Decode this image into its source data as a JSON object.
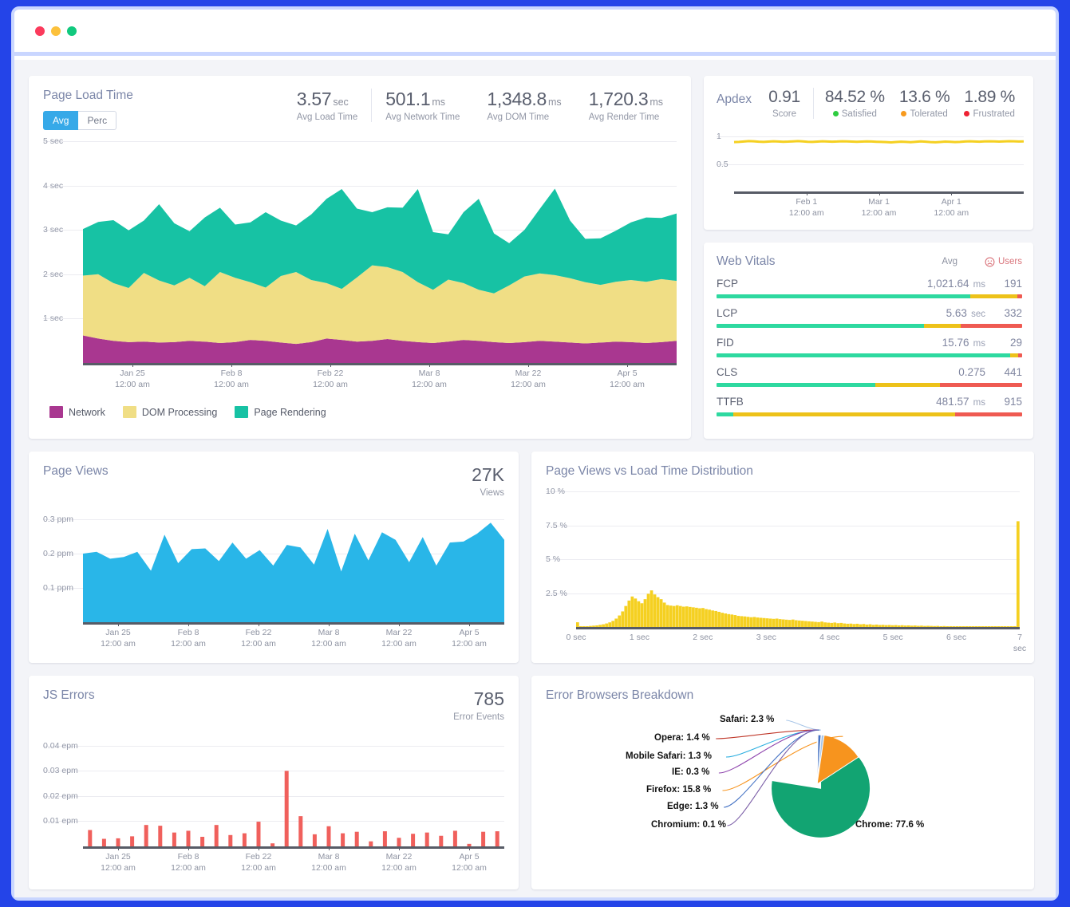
{
  "window": {
    "dots": [
      "close",
      "minimize",
      "maximize"
    ]
  },
  "page_load": {
    "title": "Page Load Time",
    "toggle": {
      "avg": "Avg",
      "perc": "Perc",
      "selected": "Avg"
    },
    "metrics": [
      {
        "value": "3.57",
        "unit": "sec",
        "label": "Avg Load Time"
      },
      {
        "value": "501.1",
        "unit": "ms",
        "label": "Avg Network Time"
      },
      {
        "value": "1,348.8",
        "unit": "ms",
        "label": "Avg DOM Time"
      },
      {
        "value": "1,720.3",
        "unit": "ms",
        "label": "Avg Render Time"
      }
    ],
    "legend": [
      {
        "label": "Network",
        "color": "#a93790"
      },
      {
        "label": "DOM Processing",
        "color": "#f0de85"
      },
      {
        "label": "Page Rendering",
        "color": "#17c2a4"
      }
    ]
  },
  "apdex": {
    "title": "Apdex",
    "score": {
      "value": "0.91",
      "label": "Score"
    },
    "buckets": [
      {
        "value": "84.52 %",
        "label": "Satisfied",
        "color": "#2ecc40"
      },
      {
        "value": "13.6 %",
        "label": "Tolerated",
        "color": "#f79a1e"
      },
      {
        "value": "1.89 %",
        "label": "Frustrated",
        "color": "#ee2233"
      }
    ]
  },
  "web_vitals": {
    "title": "Web Vitals",
    "col_avg": "Avg",
    "col_users": "Users",
    "users_icon": "frowning-face-icon",
    "rows": [
      {
        "name": "FCP",
        "value": "1,021.64",
        "unit": "ms",
        "users": "191",
        "good": 83,
        "needs": 15.5,
        "poor": 1.5
      },
      {
        "name": "LCP",
        "value": "5.63",
        "unit": "sec",
        "users": "332",
        "good": 68,
        "needs": 12,
        "poor": 20
      },
      {
        "name": "FID",
        "value": "15.76",
        "unit": "ms",
        "users": "29",
        "good": 96,
        "needs": 2.6,
        "poor": 1.4
      },
      {
        "name": "CLS",
        "value": "0.275",
        "unit": "",
        "users": "441",
        "good": 52,
        "needs": 21,
        "poor": 27
      },
      {
        "name": "TTFB",
        "value": "481.57",
        "unit": "ms",
        "users": "915",
        "good": 5.5,
        "needs": 72.5,
        "poor": 22
      }
    ],
    "colors": {
      "good": "#2ed9a0",
      "needs": "#edc21a",
      "poor": "#ef5a52"
    }
  },
  "page_views": {
    "title": "Page Views",
    "total": "27K",
    "total_label": "Views"
  },
  "distribution": {
    "title": "Page Views vs Load Time Distribution"
  },
  "js_errors": {
    "title": "JS Errors",
    "total": "785",
    "total_label": "Error Events"
  },
  "browsers": {
    "title": "Error Browsers Breakdown"
  },
  "chart_data": [
    {
      "id": "page-load-time",
      "type": "area",
      "stacked": true,
      "title": "Page Load Time",
      "ylabel": "",
      "ylim": [
        0,
        5
      ],
      "yticks": [
        "1 sec",
        "2 sec",
        "3 sec",
        "4 sec",
        "5 sec"
      ],
      "ytick_values": [
        1,
        2,
        3,
        4,
        5
      ],
      "xticks": [
        "Jan 25",
        "Feb 8",
        "Feb 22",
        "Mar 8",
        "Mar 22",
        "Apr 5"
      ],
      "xtick_sub": "12:00 am",
      "grid": true,
      "legend_position": "bottom-left",
      "series": [
        {
          "name": "Network",
          "color": "#a93790",
          "values": [
            0.62,
            0.55,
            0.5,
            0.47,
            0.48,
            0.46,
            0.47,
            0.5,
            0.48,
            0.45,
            0.47,
            0.52,
            0.5,
            0.46,
            0.43,
            0.47,
            0.55,
            0.52,
            0.48,
            0.5,
            0.54,
            0.5,
            0.47,
            0.45,
            0.48,
            0.52,
            0.5,
            0.47,
            0.45,
            0.47,
            0.5,
            0.48,
            0.46,
            0.44,
            0.46,
            0.48,
            0.47,
            0.45,
            0.47,
            0.5
          ]
        },
        {
          "name": "DOM Processing",
          "color": "#f0de85",
          "values": [
            1.35,
            1.45,
            1.3,
            1.22,
            1.55,
            1.4,
            1.28,
            1.42,
            1.25,
            1.6,
            1.45,
            1.3,
            1.2,
            1.5,
            1.62,
            1.4,
            1.25,
            1.15,
            1.45,
            1.7,
            1.62,
            1.55,
            1.35,
            1.2,
            1.4,
            1.28,
            1.15,
            1.1,
            1.3,
            1.48,
            1.52,
            1.5,
            1.45,
            1.38,
            1.3,
            1.35,
            1.4,
            1.38,
            1.42,
            1.35
          ]
        },
        {
          "name": "Page Rendering",
          "color": "#17c2a4",
          "values": [
            1.05,
            1.18,
            1.42,
            1.3,
            1.18,
            1.72,
            1.4,
            1.05,
            1.55,
            1.45,
            1.2,
            1.35,
            1.7,
            1.25,
            1.05,
            1.48,
            1.9,
            2.25,
            1.55,
            1.2,
            1.35,
            1.45,
            2.1,
            1.3,
            1.02,
            1.6,
            2.05,
            1.35,
            0.95,
            1.05,
            1.45,
            1.95,
            1.3,
            0.98,
            1.05,
            1.15,
            1.3,
            1.45,
            1.38,
            1.52
          ]
        }
      ]
    },
    {
      "id": "apdex-trend",
      "type": "line",
      "title": "Apdex",
      "color": "#f5d021",
      "ylim": [
        0,
        1.15
      ],
      "yticks": [
        "0.5",
        "1"
      ],
      "ytick_values": [
        0.5,
        1
      ],
      "xticks": [
        "Feb 1",
        "Mar 1",
        "Apr 1"
      ],
      "xtick_sub": "12:00 am",
      "values": [
        0.9,
        0.905,
        0.912,
        0.918,
        0.915,
        0.908,
        0.905,
        0.91,
        0.916,
        0.912,
        0.906,
        0.909,
        0.914,
        0.918,
        0.913,
        0.907,
        0.904,
        0.909,
        0.915,
        0.912,
        0.908,
        0.911,
        0.916,
        0.913,
        0.909,
        0.906,
        0.91,
        0.914,
        0.911,
        0.907,
        0.904,
        0.9,
        0.896,
        0.902,
        0.908,
        0.905,
        0.899,
        0.906,
        0.913,
        0.908,
        0.901,
        0.897,
        0.903,
        0.91,
        0.906,
        0.9,
        0.905,
        0.912,
        0.915,
        0.911,
        0.908,
        0.913,
        0.916,
        0.914,
        0.91,
        0.913,
        0.917,
        0.915,
        0.912,
        0.914
      ]
    },
    {
      "id": "page-views",
      "type": "area",
      "title": "Page Views",
      "color": "#29b6e8",
      "ylabel": "ppm",
      "ylim": [
        0,
        0.33
      ],
      "yticks": [
        "0.1 ppm",
        "0.2 ppm",
        "0.3 ppm"
      ],
      "ytick_values": [
        0.1,
        0.2,
        0.3
      ],
      "xticks": [
        "Jan 25",
        "Feb 8",
        "Feb 22",
        "Mar 8",
        "Mar 22",
        "Apr 5"
      ],
      "xtick_sub": "12:00 am",
      "values": [
        0.2,
        0.205,
        0.185,
        0.19,
        0.205,
        0.15,
        0.255,
        0.172,
        0.213,
        0.215,
        0.178,
        0.232,
        0.185,
        0.21,
        0.165,
        0.225,
        0.218,
        0.168,
        0.272,
        0.148,
        0.258,
        0.18,
        0.262,
        0.24,
        0.175,
        0.248,
        0.165,
        0.232,
        0.235,
        0.258,
        0.29,
        0.24
      ]
    },
    {
      "id": "load-time-distribution",
      "type": "bar",
      "title": "Page Views vs Load Time Distribution",
      "color": "#f5d021",
      "ylim": [
        0,
        10
      ],
      "yticks": [
        "2.5 %",
        "5 %",
        "7.5 %",
        "10 %"
      ],
      "ytick_values": [
        2.5,
        5,
        7.5,
        10
      ],
      "xticks": [
        "0 sec",
        "1 sec",
        "2 sec",
        "3 sec",
        "4 sec",
        "5 sec",
        "6 sec",
        "7 sec"
      ],
      "xlim": [
        0,
        7
      ],
      "values": [
        0.35,
        0.05,
        0.05,
        0.05,
        0.08,
        0.1,
        0.12,
        0.16,
        0.2,
        0.26,
        0.34,
        0.45,
        0.62,
        0.85,
        1.15,
        1.55,
        1.95,
        2.25,
        2.1,
        1.9,
        1.75,
        2.05,
        2.45,
        2.7,
        2.4,
        2.2,
        2.05,
        1.8,
        1.62,
        1.58,
        1.55,
        1.6,
        1.55,
        1.5,
        1.52,
        1.48,
        1.45,
        1.42,
        1.38,
        1.4,
        1.32,
        1.28,
        1.22,
        1.18,
        1.12,
        1.05,
        1.0,
        0.95,
        0.92,
        0.88,
        0.82,
        0.8,
        0.78,
        0.75,
        0.72,
        0.74,
        0.7,
        0.68,
        0.66,
        0.64,
        0.62,
        0.6,
        0.62,
        0.58,
        0.56,
        0.54,
        0.52,
        0.55,
        0.5,
        0.48,
        0.46,
        0.44,
        0.42,
        0.4,
        0.38,
        0.36,
        0.4,
        0.34,
        0.32,
        0.3,
        0.33,
        0.28,
        0.3,
        0.26,
        0.24,
        0.25,
        0.22,
        0.24,
        0.2,
        0.22,
        0.18,
        0.2,
        0.16,
        0.18,
        0.15,
        0.16,
        0.14,
        0.15,
        0.13,
        0.14,
        0.12,
        0.13,
        0.11,
        0.12,
        0.1,
        0.11,
        0.09,
        0.1,
        0.08,
        0.09,
        0.08,
        0.07,
        0.08,
        0.06,
        0.07,
        0.05,
        0.06,
        0.05,
        0.04,
        0.05,
        0.04,
        0.03,
        0.04,
        0.03,
        0.02,
        0.03,
        0.02,
        0.02,
        0.01,
        0.02,
        0.01,
        0.01,
        0.01,
        0.01,
        0.01,
        0.01,
        0.01,
        7.8
      ]
    },
    {
      "id": "js-errors",
      "type": "bar",
      "title": "JS Errors",
      "color": "#f0605c",
      "ylabel": "epm",
      "ylim": [
        0,
        0.045
      ],
      "yticks": [
        "0.01 epm",
        "0.02 epm",
        "0.03 epm",
        "0.04 epm"
      ],
      "ytick_values": [
        0.01,
        0.02,
        0.03,
        0.04
      ],
      "xticks": [
        "Jan 25",
        "Feb 8",
        "Feb 22",
        "Mar 8",
        "Mar 22",
        "Apr 5"
      ],
      "xtick_sub": "12:00 am",
      "values": [
        0.0065,
        0.003,
        0.0032,
        0.004,
        0.0085,
        0.0082,
        0.0055,
        0.0062,
        0.0038,
        0.0085,
        0.0045,
        0.0052,
        0.0098,
        0.0012,
        0.03,
        0.012,
        0.0048,
        0.008,
        0.0052,
        0.0058,
        0.002,
        0.006,
        0.0034,
        0.005,
        0.0055,
        0.0042,
        0.0062,
        0.001,
        0.0058,
        0.006
      ]
    },
    {
      "id": "error-browsers-breakdown",
      "type": "pie",
      "title": "Error Browsers Breakdown",
      "labels": [
        "Chrome",
        "Firefox",
        "Safari",
        "Opera",
        "Mobile Safari",
        "Edge",
        "IE",
        "Chromium"
      ],
      "values": [
        77.6,
        15.8,
        2.3,
        1.4,
        1.3,
        1.3,
        0.3,
        0.1
      ],
      "display_labels": [
        "Chrome: 77.6 %",
        "Firefox: 15.8 %",
        "Safari: 2.3 %",
        "Opera: 1.4 %",
        "Mobile Safari: 1.3 %",
        "Edge: 1.3 %",
        "IE: 0.3 %",
        "Chromium: 0.1 %"
      ],
      "colors": [
        "#12a472",
        "#f7941e",
        "#a8c6e8",
        "#c0392b",
        "#2aaee0",
        "#4472c4",
        "#8e44ad",
        "#7b5ea7"
      ]
    }
  ]
}
